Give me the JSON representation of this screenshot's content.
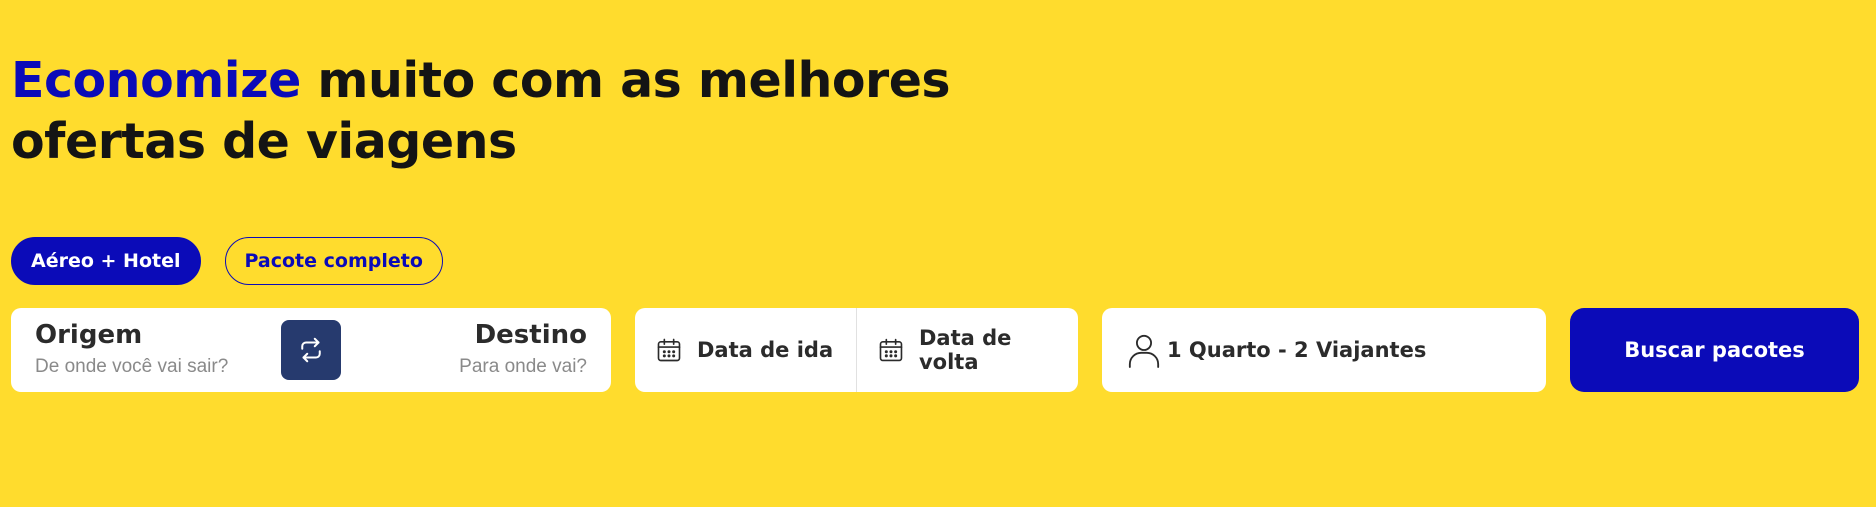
{
  "hero": {
    "headline_accent": "Economize",
    "headline_line1_rest": " muito com as melhores",
    "headline_line2": "ofertas de viagens"
  },
  "tabs": [
    {
      "label": "Aéreo + Hotel",
      "active": true
    },
    {
      "label": "Pacote completo",
      "active": false
    }
  ],
  "search": {
    "origin": {
      "label": "Origem",
      "placeholder": "De onde você vai sair?"
    },
    "destination": {
      "label": "Destino",
      "placeholder": "Para onde vai?"
    },
    "swap_icon": "swap-arrows-icon",
    "departure_date": {
      "label": "Data de ida",
      "icon": "calendar-icon"
    },
    "return_date": {
      "label": "Data de volta",
      "icon": "calendar-icon"
    },
    "guests": {
      "label": "1 Quarto - 2 Viajantes",
      "icon": "person-icon"
    },
    "submit_label": "Buscar pacotes"
  },
  "colors": {
    "background": "#FFDC2D",
    "brand_blue": "#0B0BB8",
    "swap_button": "#263A6E",
    "text_dark": "#141414"
  }
}
